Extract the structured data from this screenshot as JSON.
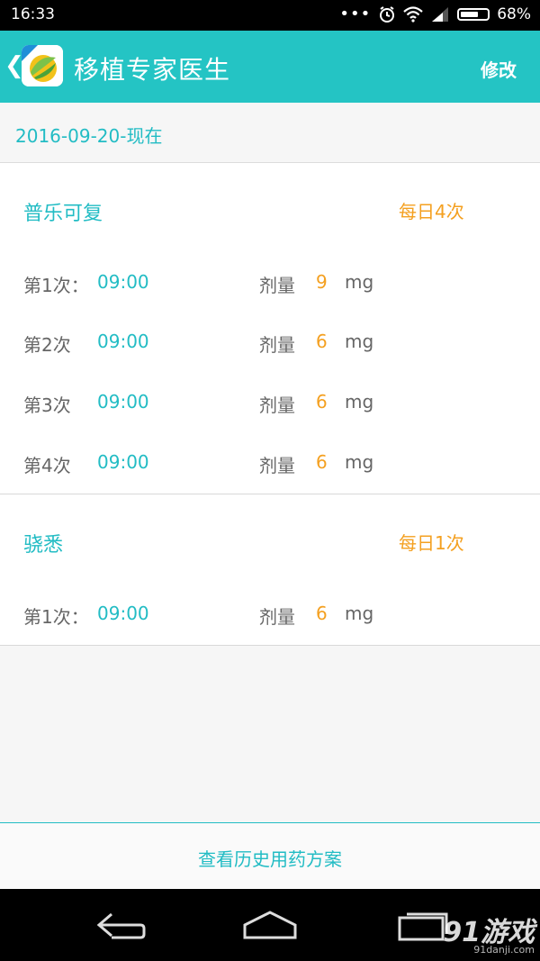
{
  "status_bar": {
    "time": "16:33",
    "battery": "68%",
    "battery_level": 0.68,
    "icons": [
      "more-dots-icon",
      "alarm-icon",
      "wifi-icon",
      "signal-icon",
      "battery-icon"
    ],
    "dots": "•••"
  },
  "header": {
    "back_glyph": "❮",
    "title": "移植专家医生",
    "edit_label": "修改",
    "background": "#24c4c4"
  },
  "date_range": "2016-09-20-现在",
  "medications": [
    {
      "name": "普乐可复",
      "frequency": "每日4次",
      "doses": [
        {
          "label": "第1次：",
          "time": "09:00",
          "qty_label": "剂量",
          "value": "9",
          "unit": "mg"
        },
        {
          "label": "第2次",
          "time": "09:00",
          "qty_label": "剂量",
          "value": "6",
          "unit": "mg"
        },
        {
          "label": "第3次",
          "time": "09:00",
          "qty_label": "剂量",
          "value": "6",
          "unit": "mg"
        },
        {
          "label": "第4次",
          "time": "09:00",
          "qty_label": "剂量",
          "value": "6",
          "unit": "mg"
        }
      ]
    },
    {
      "name": "骁悉",
      "frequency": "每日1次",
      "doses": [
        {
          "label": "第1次：",
          "time": "09:00",
          "qty_label": "剂量",
          "value": "6",
          "unit": "mg"
        }
      ]
    }
  ],
  "footer": {
    "history_label": "查看历史用药方案"
  },
  "colors": {
    "accent": "#22bcc4",
    "orange": "#f4a020",
    "text_gray": "#666666"
  },
  "watermark": {
    "main": "91游戏",
    "sub": "91danji.com"
  }
}
